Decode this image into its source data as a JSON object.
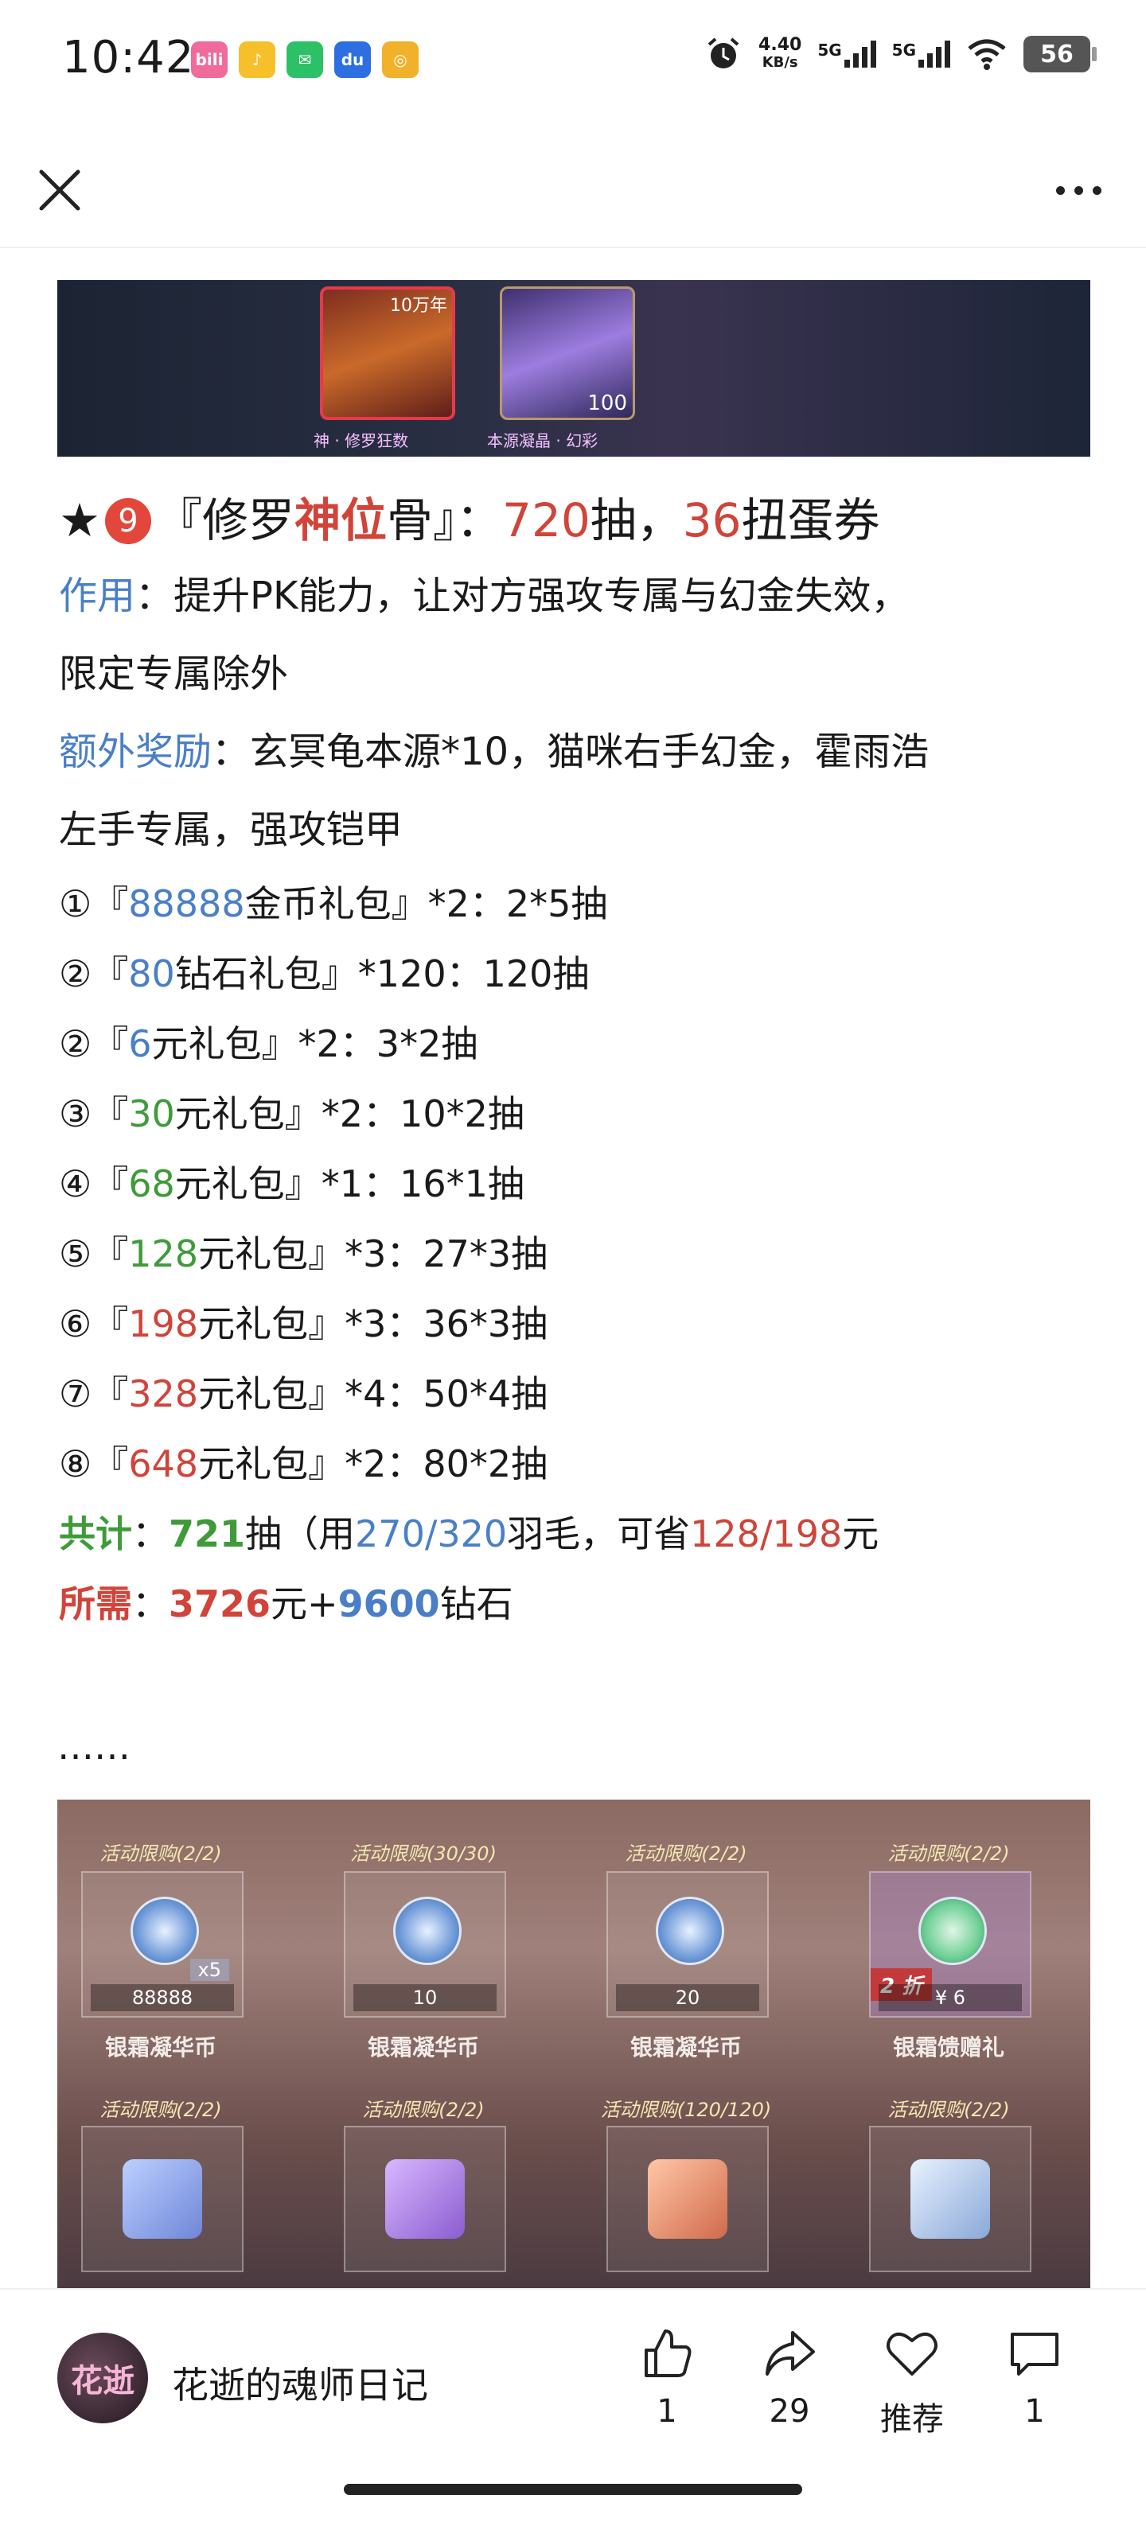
{
  "status_bar": {
    "time": "10:42",
    "apps": [
      {
        "icon": "bilibili-icon",
        "label": "bili",
        "color": "#f06a9b"
      },
      {
        "icon": "qq-music-icon",
        "label": "♪",
        "color": "#f5c02a"
      },
      {
        "icon": "wechat-icon",
        "label": "✉",
        "color": "#2dc167"
      },
      {
        "icon": "baidu-icon",
        "label": "du",
        "color": "#2d6fe0"
      },
      {
        "icon": "app-icon",
        "label": "◎",
        "color": "#f2b12a"
      }
    ],
    "net_speed_value": "4.40",
    "net_speed_unit": "KB/s",
    "signal_1": "5G",
    "signal_2": "5G",
    "battery": "56"
  },
  "nav": {
    "close_icon": "close-icon",
    "more_icon": "more-icon"
  },
  "banner_top": {
    "card1_top": "10万年",
    "card2_count": "100",
    "caption1": "神 · 修罗狂数",
    "caption2": "本源凝晶 · 幻彩"
  },
  "article": {
    "heading": {
      "star": "★",
      "num": "9",
      "open": "『修罗",
      "highlight": "神位",
      "close": "骨』：",
      "draws": "720",
      "draws_unit": "抽，",
      "coupons": "36",
      "coupons_unit": "扭蛋券"
    },
    "effect_label": "作用",
    "effect_text": "：提升PK能力，让对方强攻专属与幻金失效，",
    "effect_text2": "限定专属除外",
    "bonus_label": "额外奖励",
    "bonus_text": "：玄冥龟本源*10，猫咪右手幻金，霍雨浩",
    "bonus_text2": "左手专属，强攻铠甲",
    "items": [
      {
        "num": "①『",
        "value": "88888",
        "color": "blue",
        "rest": "金币礼包』*2：2*5抽"
      },
      {
        "num": "②『",
        "value": "80",
        "color": "blue",
        "rest": "钻石礼包』*120：120抽"
      },
      {
        "num": "②『",
        "value": "6",
        "color": "blue",
        "rest": "元礼包』*2：3*2抽"
      },
      {
        "num": "③『",
        "value": "30",
        "color": "green",
        "rest": "元礼包』*2：10*2抽"
      },
      {
        "num": "④『",
        "value": "68",
        "color": "green",
        "rest": "元礼包』*1：16*1抽"
      },
      {
        "num": "⑤『",
        "value": "128",
        "color": "green",
        "rest": "元礼包』*3：27*3抽"
      },
      {
        "num": "⑥『",
        "value": "198",
        "color": "red",
        "rest": "元礼包』*3：36*3抽"
      },
      {
        "num": "⑦『",
        "value": "328",
        "color": "red",
        "rest": "元礼包』*4：50*4抽"
      },
      {
        "num": "⑧『",
        "value": "648",
        "color": "red",
        "rest": "元礼包』*2：80*2抽"
      }
    ],
    "total": {
      "label": "共计",
      "colon": "：",
      "value": "721",
      "t1": "抽（用",
      "feathers": "270/320",
      "t2": "羽毛，可省",
      "saved": "128/198",
      "t3": "元"
    },
    "required": {
      "label": "所需",
      "colon": "：",
      "money": "3726",
      "t1": "元+",
      "diamonds": "9600",
      "t2": "钻石"
    },
    "ellipsis": "……"
  },
  "shop_banner": {
    "tiles_row1": [
      {
        "tag": "活动限购(2/2)",
        "price": "88888",
        "qty": "x5",
        "name": "银霜凝华币"
      },
      {
        "tag": "活动限购(30/30)",
        "price": "10",
        "qty": "",
        "name": "银霜凝华币"
      },
      {
        "tag": "活动限购(2/2)",
        "price": "20",
        "qty": "",
        "name": "银霜凝华币"
      },
      {
        "tag": "活动限购(2/2)",
        "price": "¥ 6",
        "qty": "",
        "name": "银霜馈赠礼",
        "discount": "2 折"
      }
    ],
    "tiles_row2": [
      {
        "tag": "活动限购(2/2)"
      },
      {
        "tag": "活动限购(2/2)"
      },
      {
        "tag": "活动限购(120/120)"
      },
      {
        "tag": "活动限购(2/2)"
      }
    ]
  },
  "bottom_bar": {
    "avatar_text": "花逝",
    "author": "花逝的魂师日记",
    "like_count": "1",
    "share_count": "29",
    "recommend_label": "推荐",
    "comment_count": "1"
  }
}
